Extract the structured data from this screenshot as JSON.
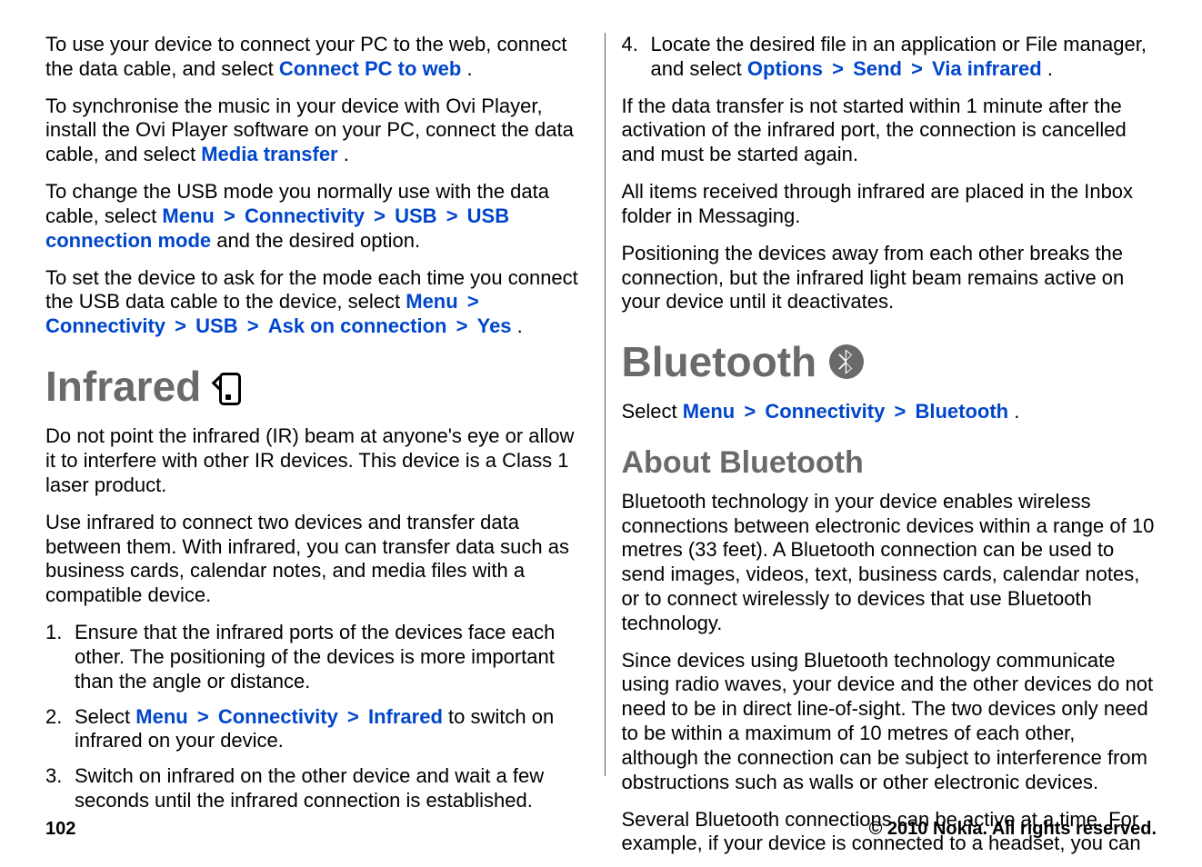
{
  "left": {
    "p1_a": "To use your device to connect your PC to the web, connect the data cable, and select ",
    "p1_link": "Connect PC to web",
    "p1_b": ".",
    "p2_a": "To synchronise the music in your device with Ovi Player, install the Ovi Player software on your PC, connect the data cable, and select ",
    "p2_link": "Media transfer",
    "p2_b": ".",
    "p3_a": "To change the USB mode you normally use with the data cable, select ",
    "p3_menu": "Menu",
    "p3_conn": "Connectivity",
    "p3_usb": "USB",
    "p3_mode": "USB connection mode",
    "p3_b": " and the desired option.",
    "p4_a": "To set the device to ask for the mode each time you connect the USB data cable to the device, select ",
    "p4_menu": "Menu",
    "p4_conn": "Connectivity",
    "p4_usb": "USB",
    "p4_ask": "Ask on connection",
    "p4_yes": "Yes",
    "p4_b": ".",
    "h1": "Infrared",
    "p5": "Do not point the infrared (IR) beam at anyone's eye or allow it to interfere with other IR devices. This device is a Class 1 laser product.",
    "p6": "Use infrared to connect two devices and transfer data between them. With infrared, you can transfer data such as business cards, calendar notes, and media files with a compatible device.",
    "li1": "Ensure that the infrared ports of the devices face each other. The positioning of the devices is more important than the angle or distance.",
    "li2_a": "Select ",
    "li2_menu": "Menu",
    "li2_conn": "Connectivity",
    "li2_ir": "Infrared",
    "li2_b": " to switch on infrared on your device.",
    "li3": "Switch on infrared on the other device and wait a few seconds until the infrared connection is established."
  },
  "right": {
    "li4_a": "Locate the desired file in an application or File manager, and select ",
    "li4_opt": "Options",
    "li4_send": "Send",
    "li4_via": "Via infrared",
    "li4_b": ".",
    "p1": "If the data transfer is not started within 1 minute after the activation of the infrared port, the connection is cancelled and must be started again.",
    "p2": "All items received through infrared are placed in the Inbox folder in Messaging.",
    "p3": "Positioning the devices away from each other breaks the connection, but the infrared light beam remains active on your device until it deactivates.",
    "h1": "Bluetooth",
    "sel_a": "Select ",
    "sel_menu": "Menu",
    "sel_conn": "Connectivity",
    "sel_bt": "Bluetooth",
    "sel_b": ".",
    "h2": "About Bluetooth",
    "p4": "Bluetooth technology in your device enables wireless connections between electronic devices within a range of 10 metres (33 feet). A Bluetooth connection can be used to send images, videos, text, business cards, calendar notes, or to connect wirelessly to devices that use Bluetooth technology.",
    "p5": "Since devices using Bluetooth technology communicate using radio waves, your device and the other devices do not need to be in direct line-of-sight. The two devices only need to be within a maximum of 10 metres of each other, although the connection can be subject to interference from obstructions such as walls or other electronic devices.",
    "p6": "Several Bluetooth connections can be active at a time. For example, if your device is connected to a headset, you can"
  },
  "sep": ">",
  "footer": {
    "page": "102",
    "copyright": "© 2010 Nokia. All rights reserved."
  }
}
